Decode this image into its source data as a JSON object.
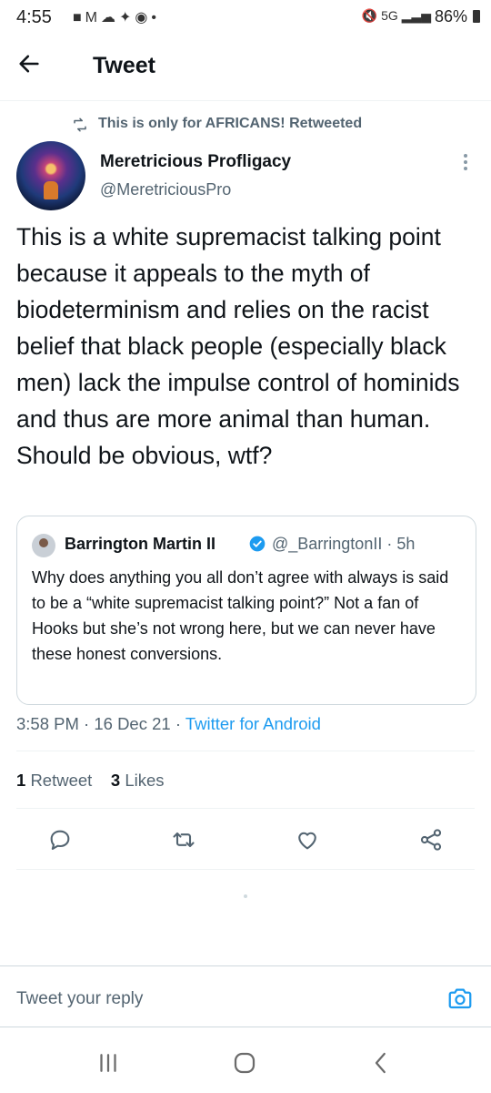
{
  "status_bar": {
    "time": "4:55",
    "notification_icons": [
      "chat-icon",
      "gmail-icon",
      "cloud-icon",
      "twitter-icon",
      "reddit-icon",
      "dot-icon"
    ],
    "system_icons": [
      "mute-icon",
      "5g-icon",
      "signal-icon"
    ],
    "network": "5G",
    "battery": "86%"
  },
  "header": {
    "title": "Tweet"
  },
  "retweet_context": {
    "text": "This is only for AFRICANS! Retweeted"
  },
  "tweet": {
    "author_name": "Meretricious Profligacy",
    "author_handle": "@MeretriciousPro",
    "text": "This is a white supremacist talking point because it appeals to the myth of biodeterminism and relies on the racist belief that black people (especially black men) lack the impulse control of hominids and thus are more animal than human. Should be obvious, wtf?",
    "time": "3:58 PM",
    "date": "16 Dec 21",
    "separator": "·",
    "source": "Twitter for Android"
  },
  "quoted_tweet": {
    "author_name": "Barrington Martin II",
    "handle": "@_BarringtonII",
    "age": "5h",
    "separator": "·",
    "text": "Why does anything you all don’t agree with always is said to be a “white supremacist talking point?” Not a fan of Hooks but she’s not wrong here, but we can never have these honest conversions."
  },
  "stats": {
    "retweets_count": "1",
    "retweets_label": "Retweet",
    "likes_count": "3",
    "likes_label": "Likes"
  },
  "actions": [
    "reply-icon",
    "retweet-icon",
    "like-icon",
    "share-icon"
  ],
  "reply": {
    "placeholder": "Tweet your reply"
  },
  "colors": {
    "accent": "#1d9bf0",
    "text_primary": "#0f1419",
    "text_secondary": "#536471",
    "border": "#cfd9de"
  }
}
